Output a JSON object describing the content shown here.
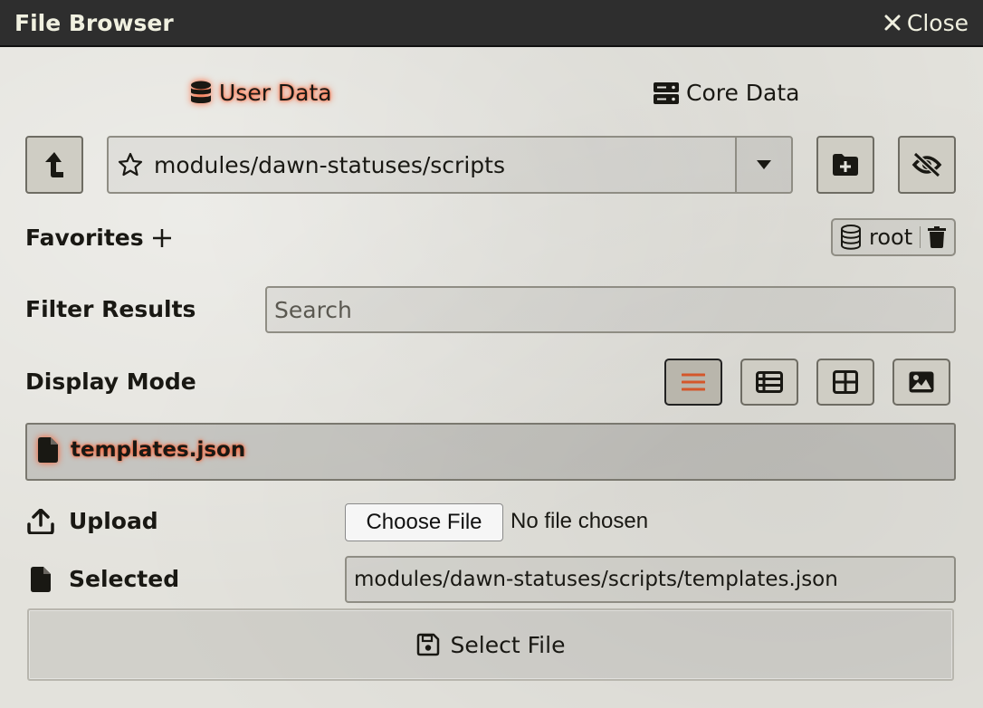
{
  "window": {
    "title": "File Browser",
    "close_label": "Close"
  },
  "sources": [
    {
      "label": "User Data",
      "icon": "database-icon",
      "active": true
    },
    {
      "label": "Core Data",
      "icon": "server-icon",
      "active": false
    }
  ],
  "navigation": {
    "current_path": "modules/dawn-statuses/scripts"
  },
  "favorites": {
    "label": "Favorites",
    "root_label": "root"
  },
  "filter": {
    "label": "Filter Results",
    "placeholder": "Search"
  },
  "display_mode": {
    "label": "Display Mode",
    "modes": [
      "list",
      "thumbs",
      "tiles",
      "images"
    ],
    "active": "list"
  },
  "files": [
    {
      "name": "templates.json",
      "icon": "file-icon",
      "selected": true
    }
  ],
  "upload": {
    "label": "Upload",
    "choose_label": "Choose File",
    "status": "No file chosen"
  },
  "selected": {
    "label": "Selected",
    "value": "modules/dawn-statuses/scripts/templates.json"
  },
  "submit": {
    "label": "Select File"
  },
  "colors": {
    "titlebar": "#2e2e2e",
    "highlight": "#ff5a2a",
    "background": "#e3e2dc"
  }
}
